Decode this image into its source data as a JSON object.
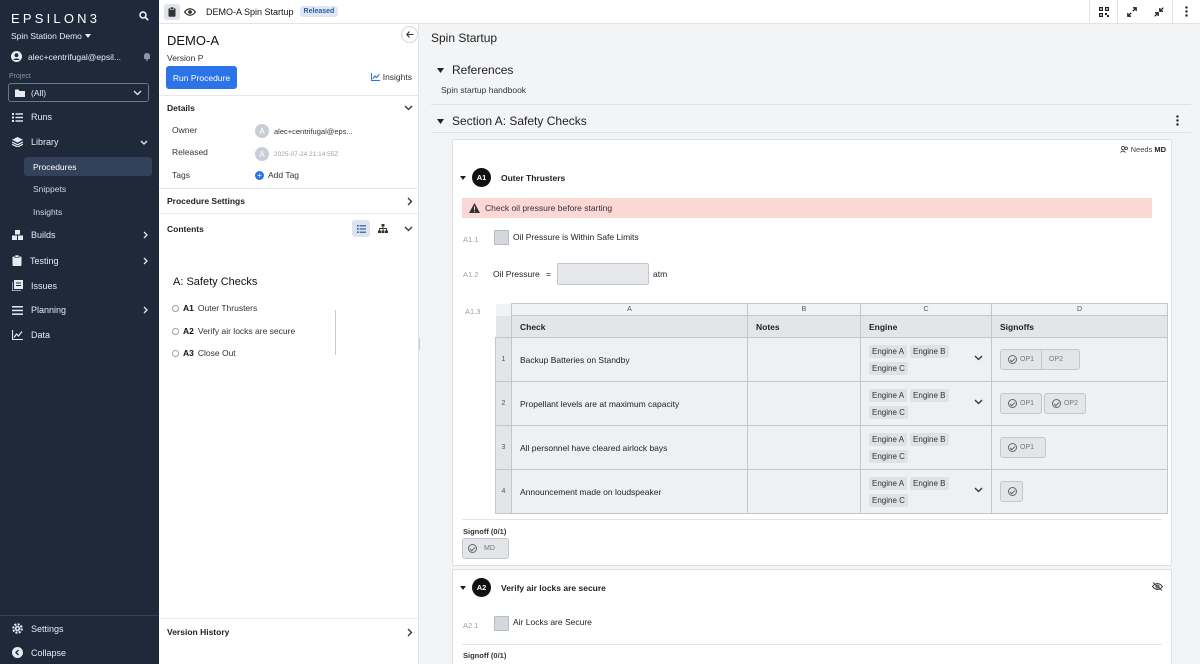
{
  "sidebar": {
    "logo": "EPSILON3",
    "team": "Spin Station Demo",
    "user": "alec+centrifugal@epsil...",
    "project_label": "Project",
    "project_value": "(All)",
    "nav": {
      "runs": "Runs",
      "library": "Library",
      "procedures": "Procedures",
      "snippets": "Snippets",
      "insights": "Insights",
      "builds": "Builds",
      "testing": "Testing",
      "issues": "Issues",
      "planning": "Planning",
      "data": "Data",
      "settings": "Settings",
      "collapse": "Collapse"
    }
  },
  "topbar": {
    "title": "DEMO-A Spin Startup",
    "status": "Released"
  },
  "panel": {
    "title": "DEMO-A",
    "version": "Version P",
    "run_button": "Run Procedure",
    "insights": "Insights",
    "details": {
      "heading": "Details",
      "owner_label": "Owner",
      "owner_value": "alec+centrifugal@eps...",
      "released_label": "Released",
      "released_value": "2025-07-24 21:14:55Z",
      "tags_label": "Tags",
      "add_tag": "Add Tag",
      "avatar_letter": "A"
    },
    "procedure_settings": "Procedure Settings",
    "contents": "Contents",
    "toc": {
      "heading": "A: Safety Checks",
      "items": [
        {
          "num": "A1",
          "label": "Outer Thrusters"
        },
        {
          "num": "A2",
          "label": "Verify air locks are secure"
        },
        {
          "num": "A3",
          "label": "Close Out"
        }
      ]
    },
    "version_history": "Version History"
  },
  "main": {
    "title": "Spin Startup",
    "references": {
      "heading": "References",
      "text": "Spin startup handbook"
    },
    "section": "Section A: Safety Checks",
    "step1": {
      "needs_prefix": "Needs",
      "needs_role": "MD",
      "num": "A1",
      "title": "Outer Thrusters",
      "warning": "Check oil pressure before starting",
      "a11": {
        "num": "A1.1",
        "label": "Oil Pressure is Within Safe Limits"
      },
      "a12": {
        "num": "A1.2",
        "label": "Oil Pressure",
        "eq": "=",
        "unit": "atm"
      },
      "a13": {
        "num": "A1.3"
      },
      "table": {
        "col_letters": [
          "A",
          "B",
          "C",
          "D"
        ],
        "headers": [
          "Check",
          "Notes",
          "Engine",
          "Signoffs"
        ],
        "rows": [
          {
            "n": "1",
            "check": "Backup Batteries on Standby",
            "notes": "",
            "engines": [
              "Engine A",
              "Engine B",
              "Engine C"
            ],
            "signoffs": [
              "OP1",
              "OP2"
            ]
          },
          {
            "n": "2",
            "check": "Propellant levels are at maximum capacity",
            "notes": "",
            "engines": [
              "Engine A",
              "Engine B",
              "Engine C"
            ],
            "signoffs": [
              "OP1",
              "OP2"
            ]
          },
          {
            "n": "3",
            "check": "All personnel have cleared airlock bays",
            "notes": "",
            "engines": [
              "Engine A",
              "Engine B",
              "Engine C"
            ],
            "signoffs": [
              "OP1"
            ]
          },
          {
            "n": "4",
            "check": "Announcement made on loudspeaker",
            "notes": "",
            "engines": [
              "Engine A",
              "Engine B",
              "Engine C"
            ],
            "signoffs": []
          }
        ]
      },
      "signoff_label": "Signoff (0/1)",
      "signoff_role": "MD"
    },
    "step2": {
      "num": "A2",
      "title": "Verify air locks are secure",
      "a21": {
        "num": "A2.1",
        "label": "Air Locks are Secure"
      },
      "signoff_label": "Signoff (0/1)"
    }
  },
  "colors": {
    "sidebar_bg": "#1e2a3a",
    "accent": "#2d73e8",
    "warning_bg": "#fbd7d5",
    "released_badge": "#dde7f5"
  }
}
